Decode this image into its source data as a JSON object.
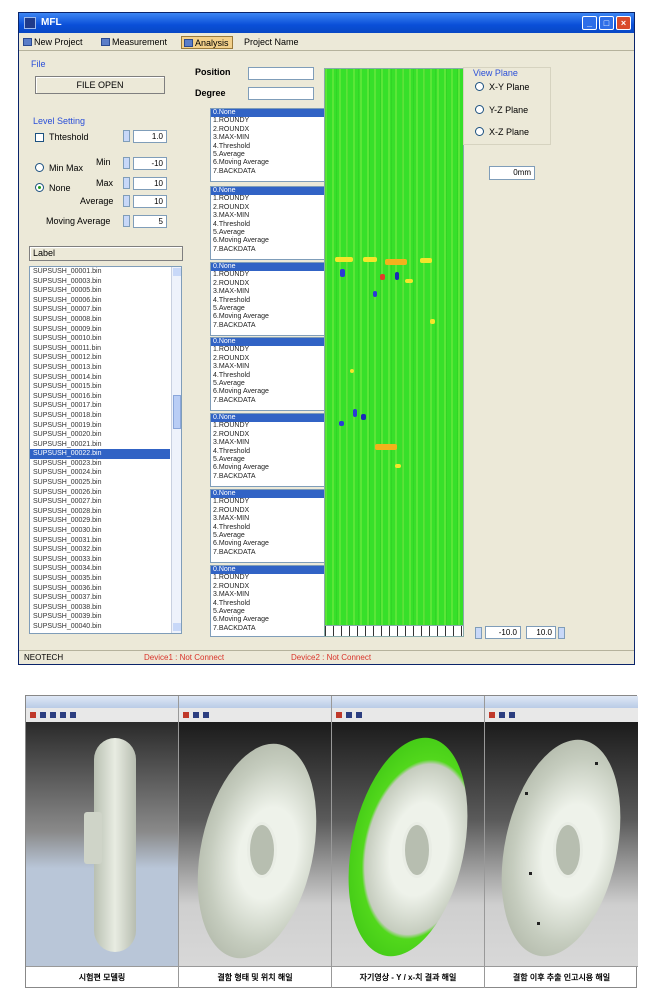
{
  "window": {
    "title": "MFL",
    "controls": [
      "_",
      "□",
      "×"
    ]
  },
  "toolbar": {
    "items": [
      "New Project",
      "Measurement",
      "Analysis",
      "Project Name"
    ],
    "active": "Analysis"
  },
  "file_section": {
    "label": "File",
    "open_button": "FILE OPEN"
  },
  "level_setting": {
    "label": "Level Setting",
    "threshold_label": "Thteshold",
    "threshold_value": "1.0",
    "min_max_label": "Min Max",
    "none_label": "None",
    "selected": "None",
    "min_label": "Min",
    "min_value": "-10",
    "max_label": "Max",
    "max_value": "10",
    "average_label": "Average",
    "average_value": "10",
    "moving_average_label": "Moving Average",
    "moving_average_value": "5"
  },
  "label_button": "Label",
  "file_list": {
    "items": [
      "SUPSUSH_00001.bin",
      "SUPSUSH_00003.bin",
      "SUPSUSH_00005.bin",
      "SUPSUSH_00006.bin",
      "SUPSUSH_00007.bin",
      "SUPSUSH_00008.bin",
      "SUPSUSH_00009.bin",
      "SUPSUSH_00010.bin",
      "SUPSUSH_00011.bin",
      "SUPSUSH_00012.bin",
      "SUPSUSH_00013.bin",
      "SUPSUSH_00014.bin",
      "SUPSUSH_00015.bin",
      "SUPSUSH_00016.bin",
      "SUPSUSH_00017.bin",
      "SUPSUSH_00018.bin",
      "SUPSUSH_00019.bin",
      "SUPSUSH_00020.bin",
      "SUPSUSH_00021.bin",
      "SUPSUSH_00022.bin",
      "SUPSUSH_00023.bin",
      "SUPSUSH_00024.bin",
      "SUPSUSH_00025.bin",
      "SUPSUSH_00026.bin",
      "SUPSUSH_00027.bin",
      "SUPSUSH_00028.bin",
      "SUPSUSH_00029.bin",
      "SUPSUSH_00030.bin",
      "SUPSUSH_00031.bin",
      "SUPSUSH_00032.bin",
      "SUPSUSH_00033.bin",
      "SUPSUSH_00034.bin",
      "SUPSUSH_00035.bin",
      "SUPSUSH_00036.bin",
      "SUPSUSH_00037.bin",
      "SUPSUSH_00038.bin",
      "SUPSUSH_00039.bin",
      "SUPSUSH_00040.bin"
    ],
    "selected_index": 19
  },
  "position_label": "Position",
  "degree_label": "Degree",
  "option_items": [
    "0.None",
    "1.ROUNDY",
    "2.ROUNDX",
    "3.MAX-MIN",
    "4.Threshold",
    "5.Average",
    "6.Moving Average",
    "7.BACKDATA"
  ],
  "view_plane": {
    "label": "View Plane",
    "options": [
      "X-Y Plane",
      "Y-Z Plane",
      "X-Z Plane"
    ],
    "unit_field": "0mm"
  },
  "range": {
    "min": "-10.0",
    "max": "10.0"
  },
  "status": {
    "company": "NEOTECH",
    "device1": "Device1 : Not Connect",
    "device2": "Device2 : Not Connect"
  },
  "panels": {
    "captions": [
      "시험편 모델링",
      "결함 형태 및 위치 해일",
      "자기영상 - Y / x-치 결과 해일",
      "결함 이후 추출 인고시용 해일"
    ]
  },
  "colors": {
    "titlebar": "#0a4fd8",
    "heatmap_base": "#37e02a",
    "selection": "#3163c5",
    "status_red": "#d9342b"
  }
}
